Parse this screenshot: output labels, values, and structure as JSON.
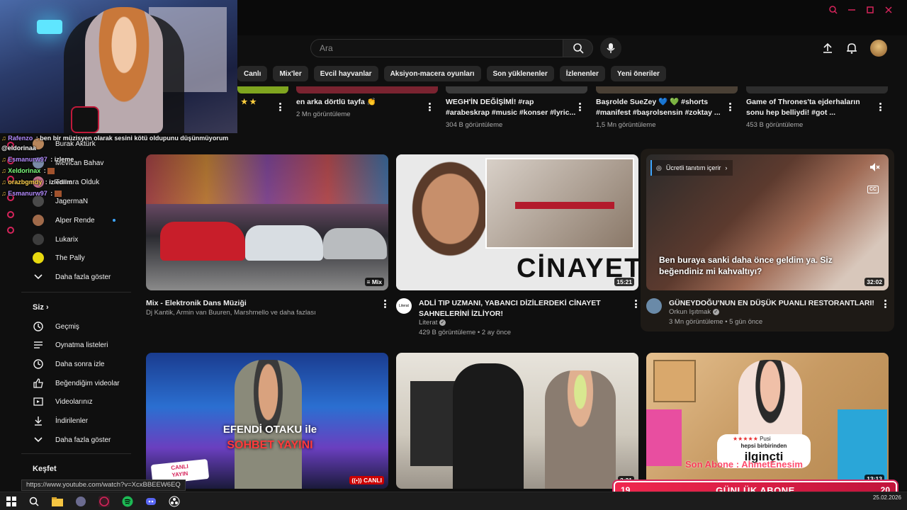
{
  "masthead": {
    "search_placeholder": "Ara"
  },
  "chips": [
    "Canlı",
    "Mix'ler",
    "Evcil hayvanlar",
    "Aksiyon-macera oyunları",
    "Son yüklenenler",
    "İzlenenler",
    "Yeni öneriler"
  ],
  "chat": [
    {
      "user": "Rafenzo",
      "text": "ben bir müzisyen olarak sesini kötü oldupunu düşünmüyorum",
      "color": "#b48cff"
    },
    {
      "user": "@eldorinaa",
      "text": "",
      "color": "#ffffff"
    },
    {
      "user": "Esmanurw97",
      "text": "izleme",
      "color": "#b48cff"
    },
    {
      "user": "Xeldorinax",
      "text": "",
      "color": "#7dff7d"
    },
    {
      "user": "orazbgmdy",
      "text": "izlediim",
      "color": "#ffd24d"
    },
    {
      "user": "Esmanurw97",
      "text": "",
      "color": "#b48cff"
    }
  ],
  "sidebar": {
    "subscriptions": [
      {
        "label": "Burak Aktürk",
        "color": "#b8865b"
      },
      {
        "label": "Mevlcan Bahav",
        "color": "#7a8aa8"
      },
      {
        "label": "Tamara Olduk",
        "color": "#c06d8a"
      },
      {
        "label": "JagermaN",
        "color": "#4a4a4a"
      },
      {
        "label": "Alper Rende",
        "color": "#a06a4a"
      },
      {
        "label": "Lukarix",
        "color": "#3d3d3d"
      },
      {
        "label": "The Pally",
        "color": "#e8d90f"
      }
    ],
    "show_more": "Daha fazla göster",
    "you_header": "Siz",
    "you_items": [
      "Geçmiş",
      "Oynatma listeleri",
      "Daha sonra izle",
      "Beğendiğim videolar",
      "Videolarınız",
      "İndirilenler",
      "Daha fazla göster"
    ],
    "explore_header": "Keşfet"
  },
  "top_row": [
    {
      "title": "★ ★",
      "meta": ""
    },
    {
      "title": "en arka dörtlü tayfa 👏",
      "meta": "2 Mn görüntüleme"
    },
    {
      "title": "WEGH'İN DEĞİŞİMİ! #rap #arabeskrap #music #konser #lyric...",
      "meta": "304 B görüntüleme"
    },
    {
      "title": "Başrolde SueZey 💙 💚 #shorts #manifest #başrolsensin #zoktay ...",
      "meta": "1,5 Mn görüntüleme"
    },
    {
      "title": "Game of Thrones'ta ejderhaların sonu hep belliydi! #got ...",
      "meta": "453 B görüntüleme"
    }
  ],
  "videos": [
    {
      "title": "Mix - Elektronik Dans Müziği",
      "channel": "Dj Kantik, Armin van Buuren, Marshmello ve daha fazlası",
      "meta": "",
      "badge": "Mix"
    },
    {
      "title": "ADLİ TIP UZMANI, YABANCI DİZİLERDEKİ CİNAYET SAHNELERİNİ İZLİYOR!",
      "channel": "Literat",
      "meta": "429 B görüntüleme • 2 ay önce",
      "duration": "15:21",
      "thumb_text": "CİNAYET",
      "chan_av_text": "Literat"
    },
    {
      "title": "GÜNEYDOĞU'NUN EN DÜŞÜK PUANLI RESTORANTLARI!",
      "channel": "Orkun Işıtmak",
      "meta": "3 Mn görüntüleme • 5 gün önce",
      "duration": "32:02",
      "promo": "Ücretli tanıtım içerir",
      "caption": "Ben buraya sanki daha önce geldim ya. Siz beğendiniz mi kahvaltıyı?",
      "cc": "CC"
    },
    {
      "title": "",
      "channel": "",
      "meta": "",
      "badge": "CANLI",
      "thumb_line1": "EFENDİ OTAKU ile",
      "thumb_line2": "SOHBET YAYINI",
      "live_tag": "CANLI YAYIN"
    },
    {
      "title": "",
      "channel": "",
      "meta": "",
      "duration": "3:21"
    },
    {
      "title": "",
      "channel": "",
      "meta": "",
      "duration": "13:13",
      "thumb_line1": "hepsi birbirinden",
      "thumb_line2": "ilginçti",
      "rating_word": "Pusi",
      "overlay_text": "Son Abone : AhmetEnesim"
    }
  ],
  "status_url": "https://www.youtube.com/watch?v=XcxBBEEW6EQ",
  "subgoal": {
    "left": "19",
    "label": "GÜNLÜK ABONE",
    "right": "20"
  },
  "taskbar": {
    "date": "25.02.2026"
  },
  "colors": {
    "accent": "#d6245b",
    "bg": "#0f0f0f",
    "chip": "#272727",
    "link": "#3ea6ff"
  }
}
